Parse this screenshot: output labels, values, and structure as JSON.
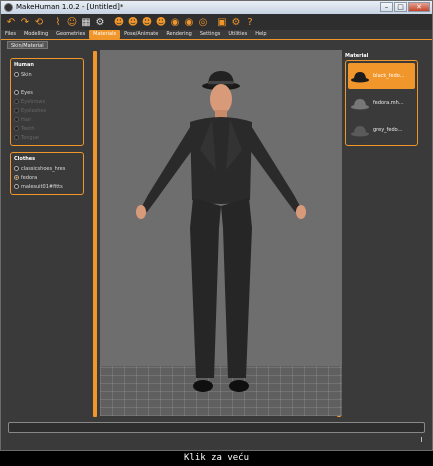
{
  "window": {
    "title": "MakeHuman 1.0.2 - [Untitled]*"
  },
  "window_buttons": {
    "minimize": "–",
    "maximize": "□",
    "close": "✕"
  },
  "menu": {
    "tabs": [
      "Files",
      "Modelling",
      "Geometries",
      "Materials",
      "Pose/Animate",
      "Rendering",
      "Settings",
      "Utilities",
      "Help"
    ],
    "active": "Materials"
  },
  "subtab": {
    "label": "Skin/Material"
  },
  "human_group": {
    "title": "Human",
    "options": [
      {
        "label": "Skin",
        "checked": false,
        "faded": false
      },
      {
        "label": "",
        "checked": false,
        "faded": false
      },
      {
        "label": "Eyes",
        "checked": false,
        "faded": false
      },
      {
        "label": "Eyebrows",
        "checked": false,
        "faded": true
      },
      {
        "label": "Eyelashes",
        "checked": false,
        "faded": true
      },
      {
        "label": "Hair",
        "checked": false,
        "faded": true
      },
      {
        "label": "Teeth",
        "checked": false,
        "faded": true
      },
      {
        "label": "Tongue",
        "checked": false,
        "faded": true
      }
    ]
  },
  "clothes_group": {
    "title": "Clothes",
    "options": [
      {
        "label": "classicshoes_hres",
        "checked": false
      },
      {
        "label": "fedora",
        "checked": true
      },
      {
        "label": "malesuit01#fitts",
        "checked": false
      }
    ]
  },
  "material_panel": {
    "title": "Material",
    "items": [
      {
        "label": "black_fedo...",
        "active": true,
        "hat_color": "#1c1c1c"
      },
      {
        "label": "fedora.mh...",
        "active": false,
        "hat_color": "#777777"
      },
      {
        "label": "grey_fedo...",
        "active": false,
        "hat_color": "#5a5a5a"
      }
    ]
  },
  "caption": {
    "text": "Klik za veću"
  },
  "colors": {
    "accent": "#f0962a",
    "background": "#3a3a3a",
    "viewport": "#6e6e6e"
  }
}
